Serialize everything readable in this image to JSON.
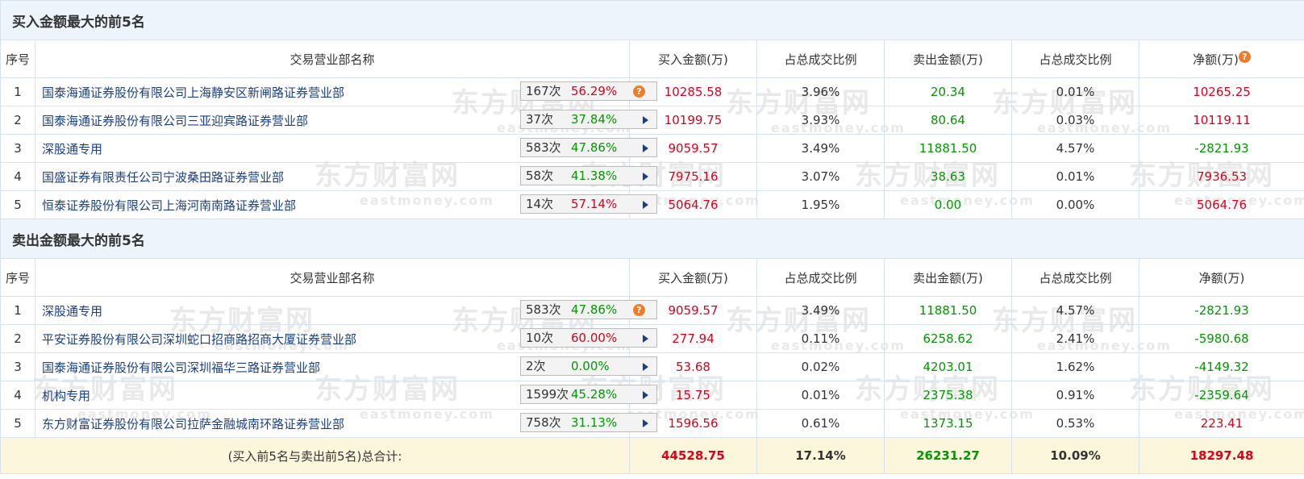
{
  "watermark": {
    "cn": "东方财富网",
    "en": "eastmoney.com"
  },
  "columns": {
    "seq": "序号",
    "name": "交易营业部名称",
    "buy": "买入金额(万)",
    "buy_pct": "占总成交比例",
    "sell": "卖出金额(万)",
    "sell_pct": "占总成交比例",
    "net": "净额(万)"
  },
  "help_icon": "question-icon",
  "buy_section": {
    "title": "买入金额最大的前5名",
    "rows": [
      {
        "seq": "1",
        "name": "国泰海通证券股份有限公司上海静安区新闸路证券营业部",
        "count": "167次",
        "rate": "56.29%",
        "rate_color": "red",
        "icon": "question",
        "buy": "10285.58",
        "buy_pct": "3.96%",
        "sell": "20.34",
        "sell_pct": "0.01%",
        "net": "10265.25",
        "net_color": "red"
      },
      {
        "seq": "2",
        "name": "国泰海通证券股份有限公司三亚迎宾路证券营业部",
        "count": "37次",
        "rate": "37.84%",
        "rate_color": "green",
        "icon": "arrow",
        "buy": "10199.75",
        "buy_pct": "3.93%",
        "sell": "80.64",
        "sell_pct": "0.03%",
        "net": "10119.11",
        "net_color": "red"
      },
      {
        "seq": "3",
        "name": "深股通专用",
        "count": "583次",
        "rate": "47.86%",
        "rate_color": "green",
        "icon": "arrow",
        "buy": "9059.57",
        "buy_pct": "3.49%",
        "sell": "11881.50",
        "sell_pct": "4.57%",
        "net": "-2821.93",
        "net_color": "green"
      },
      {
        "seq": "4",
        "name": "国盛证券有限责任公司宁波桑田路证券营业部",
        "count": "58次",
        "rate": "41.38%",
        "rate_color": "green",
        "icon": "arrow",
        "buy": "7975.16",
        "buy_pct": "3.07%",
        "sell": "38.63",
        "sell_pct": "0.01%",
        "net": "7936.53",
        "net_color": "red"
      },
      {
        "seq": "5",
        "name": "恒泰证券股份有限公司上海河南南路证券营业部",
        "count": "14次",
        "rate": "57.14%",
        "rate_color": "red",
        "icon": "arrow",
        "buy": "5064.76",
        "buy_pct": "1.95%",
        "sell": "0.00",
        "sell_pct": "0.00%",
        "net": "5064.76",
        "net_color": "red"
      }
    ]
  },
  "sell_section": {
    "title": "卖出金额最大的前5名",
    "rows": [
      {
        "seq": "1",
        "name": "深股通专用",
        "count": "583次",
        "rate": "47.86%",
        "rate_color": "green",
        "icon": "question",
        "buy": "9059.57",
        "buy_pct": "3.49%",
        "sell": "11881.50",
        "sell_pct": "4.57%",
        "net": "-2821.93",
        "net_color": "green"
      },
      {
        "seq": "2",
        "name": "平安证券股份有限公司深圳蛇口招商路招商大厦证券营业部",
        "count": "10次",
        "rate": "60.00%",
        "rate_color": "red",
        "icon": "arrow",
        "buy": "277.94",
        "buy_pct": "0.11%",
        "sell": "6258.62",
        "sell_pct": "2.41%",
        "net": "-5980.68",
        "net_color": "green"
      },
      {
        "seq": "3",
        "name": "国泰海通证券股份有限公司深圳福华三路证券营业部",
        "count": "2次",
        "rate": "0.00%",
        "rate_color": "green",
        "icon": "arrow",
        "buy": "53.68",
        "buy_pct": "0.02%",
        "sell": "4203.01",
        "sell_pct": "1.62%",
        "net": "-4149.32",
        "net_color": "green"
      },
      {
        "seq": "4",
        "name": "机构专用",
        "count": "1599次",
        "rate": "45.28%",
        "rate_color": "green",
        "icon": "arrow",
        "buy": "15.75",
        "buy_pct": "0.01%",
        "sell": "2375.38",
        "sell_pct": "0.91%",
        "net": "-2359.64",
        "net_color": "green"
      },
      {
        "seq": "5",
        "name": "东方财富证券股份有限公司拉萨金融城南环路证券营业部",
        "count": "758次",
        "rate": "31.13%",
        "rate_color": "green",
        "icon": "arrow",
        "buy": "1596.56",
        "buy_pct": "0.61%",
        "sell": "1373.15",
        "sell_pct": "0.53%",
        "net": "223.41",
        "net_color": "red"
      }
    ]
  },
  "total": {
    "label": "(买入前5名与卖出前5名)总合计:",
    "buy": "44528.75",
    "buy_pct": "17.14%",
    "sell": "26231.27",
    "sell_pct": "10.09%",
    "net": "18297.48"
  }
}
